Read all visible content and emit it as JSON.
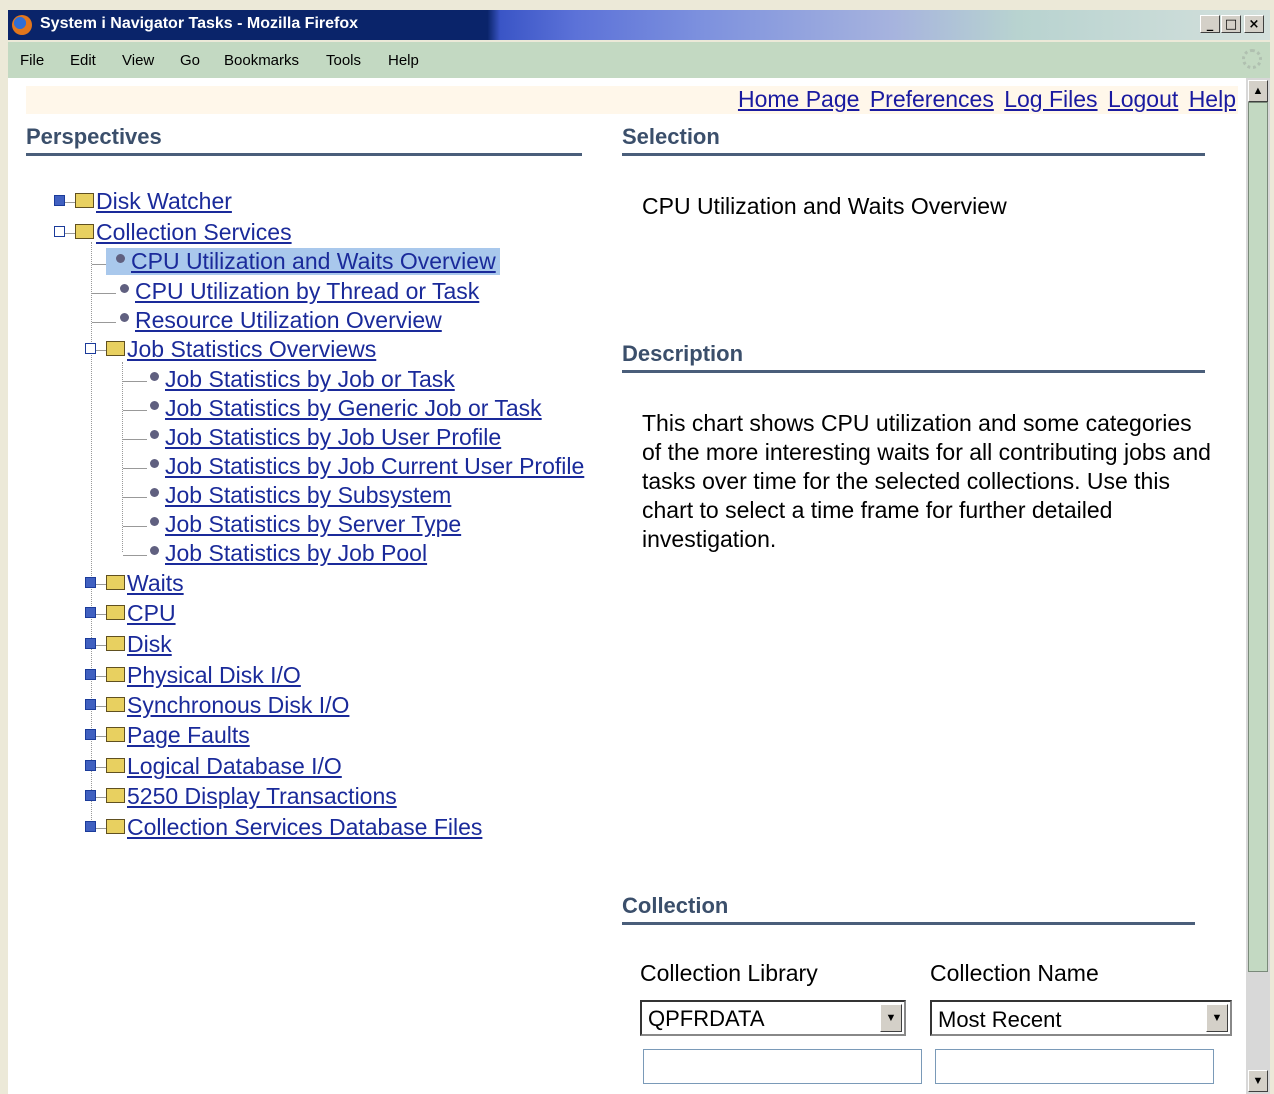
{
  "window": {
    "title": "System i Navigator Tasks - Mozilla Firefox"
  },
  "menu": [
    "File",
    "Edit",
    "View",
    "Go",
    "Bookmarks",
    "Tools",
    "Help"
  ],
  "toplinks": [
    "Home Page",
    "Preferences",
    "Log Files",
    "Logout",
    "Help"
  ],
  "perspectives": {
    "heading": "Perspectives",
    "disk_watcher": "Disk Watcher",
    "collection_services": "Collection Services",
    "items": [
      "CPU Utilization and Waits Overview",
      "CPU Utilization by Thread or Task",
      "Resource Utilization Overview"
    ],
    "job_stats_folder": "Job Statistics Overviews",
    "job_stats": [
      "Job Statistics by Job or Task",
      "Job Statistics by Generic Job or Task",
      "Job Statistics by Job User Profile",
      "Job Statistics by Job Current User Profile",
      "Job Statistics by Subsystem",
      "Job Statistics by Server Type",
      "Job Statistics by Job Pool"
    ],
    "folders": [
      "Waits",
      "CPU",
      "Disk",
      "Physical Disk I/O",
      "Synchronous Disk I/O",
      "Page Faults",
      "Logical Database I/O",
      "5250 Display Transactions",
      "Collection Services Database Files"
    ]
  },
  "selection": {
    "heading": "Selection",
    "value": "CPU Utilization and Waits Overview"
  },
  "description": {
    "heading": "Description",
    "lines": [
      "This chart shows CPU utilization and some categories",
      "of the more interesting waits for all contributing jobs and",
      "tasks over time for the selected collections. Use this",
      "chart to select a time frame for further detailed",
      "investigation."
    ]
  },
  "collection": {
    "heading": "Collection",
    "library_label": "Collection Library",
    "library_value": "QPFRDATA",
    "name_label": "Collection Name",
    "name_value": "Most Recent"
  }
}
